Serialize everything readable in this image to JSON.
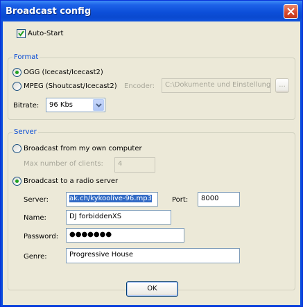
{
  "window": {
    "title": "Broadcast config"
  },
  "auto_start": {
    "label": "Auto-Start",
    "checked": true
  },
  "format": {
    "legend": "Format",
    "ogg_label": "OGG (Icecast/Icecast2)",
    "mpeg_label": "MPEG (Shoutcast/Icecast2)",
    "selected": "ogg",
    "encoder_label": "Encoder:",
    "encoder_path": "C:\\Dokumente und Einstellung",
    "browse_label": "...",
    "bitrate_label": "Bitrate:",
    "bitrate_value": "96 Kbs"
  },
  "server_group": {
    "legend": "Server",
    "own_computer_label": "Broadcast from my own computer",
    "max_clients_label": "Max number of clients:",
    "max_clients_value": "4",
    "radio_server_label": "Broadcast to a radio server",
    "selected": "radio_server",
    "server_label": "Server:",
    "server_value": "ak.ch/kykoolive-96.mp3",
    "port_label": "Port:",
    "port_value": "8000",
    "name_label": "Name:",
    "name_value": "DJ forbiddenXS",
    "password_label": "Password:",
    "password_value": "●●●●●●●",
    "genre_label": "Genre:",
    "genre_value": "Progressive House"
  },
  "ok_label": "OK",
  "colors": {
    "title_bar": "#0a49cf",
    "dialog_bg": "#ece9d8",
    "group_legend": "#0046d5",
    "selection": "#316ac5"
  }
}
